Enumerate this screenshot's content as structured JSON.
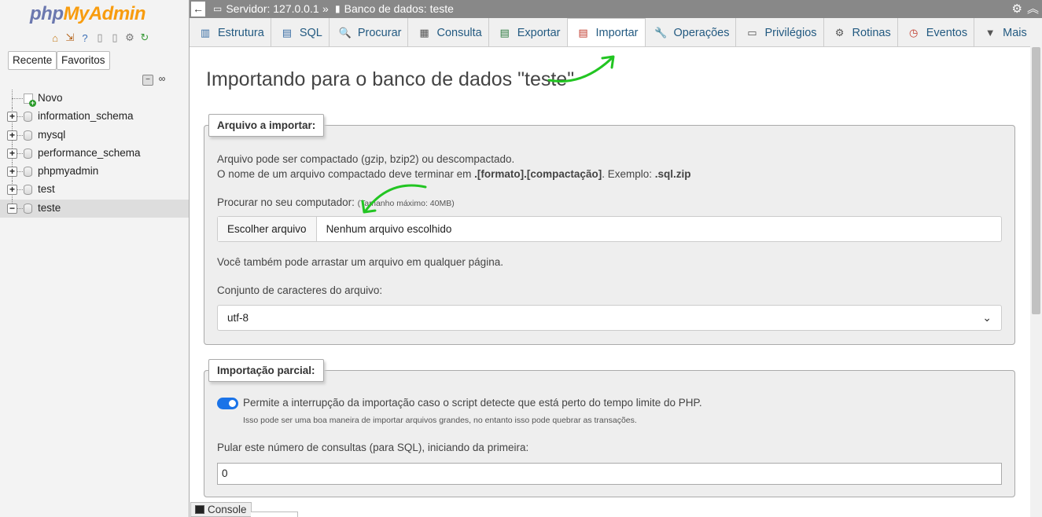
{
  "sidebar": {
    "logo_php": "php",
    "logo_myadmin": "MyAdmin",
    "tab_recent": "Recente",
    "tab_favorites": "Favoritos",
    "tree": [
      {
        "label": "Novo",
        "type": "new"
      },
      {
        "label": "information_schema",
        "type": "db"
      },
      {
        "label": "mysql",
        "type": "db"
      },
      {
        "label": "performance_schema",
        "type": "db"
      },
      {
        "label": "phpmyadmin",
        "type": "db"
      },
      {
        "label": "test",
        "type": "db"
      },
      {
        "label": "teste",
        "type": "db",
        "selected": true
      }
    ]
  },
  "topbar": {
    "server": "Servidor: 127.0.0.1",
    "separator": "»",
    "database": "Banco de dados: teste"
  },
  "tabs": [
    {
      "label": "Estrutura",
      "icon": "structure-icon"
    },
    {
      "label": "SQL",
      "icon": "sql-icon"
    },
    {
      "label": "Procurar",
      "icon": "search-icon"
    },
    {
      "label": "Consulta",
      "icon": "query-icon"
    },
    {
      "label": "Exportar",
      "icon": "export-icon"
    },
    {
      "label": "Importar",
      "icon": "import-icon",
      "active": true
    },
    {
      "label": "Operações",
      "icon": "wrench-icon"
    },
    {
      "label": "Privilégios",
      "icon": "privileges-icon"
    },
    {
      "label": "Rotinas",
      "icon": "routines-icon"
    },
    {
      "label": "Eventos",
      "icon": "clock-icon"
    },
    {
      "label": "Mais",
      "icon": "dropdown-icon"
    }
  ],
  "main": {
    "title": "Importando para o banco de dados \"teste\"",
    "file_section": {
      "legend": "Arquivo a importar:",
      "line1": "Arquivo pode ser compactado (gzip, bzip2) ou descompactado.",
      "line2_prefix": "O nome de um arquivo compactado deve terminar em ",
      "line2_bold": ".[formato].[compactação]",
      "line2_mid": ". Exemplo: ",
      "line2_example": ".sql.zip",
      "browse_label": "Procurar no seu computador:",
      "max_size": "(Tamanho máximo: 40MB)",
      "choose_button": "Escolher arquivo",
      "no_file": "Nenhum arquivo escolhido",
      "drag_hint": "Você também pode arrastar um arquivo em qualquer página.",
      "charset_label": "Conjunto de caracteres do arquivo:",
      "charset_value": "utf-8"
    },
    "partial_section": {
      "legend": "Importação parcial:",
      "toggle_label": "Permite a interrupção da importação caso o script detecte que está perto do tempo limite do PHP.",
      "toggle_on": true,
      "toggle_hint": "Isso pode ser uma boa maneira de importar arquivos grandes, no entanto isso pode quebrar as transações.",
      "skip_label": "Pular este número de consultas (para SQL), iniciando da primeira:",
      "skip_value": "0"
    }
  },
  "console": {
    "label": "Console"
  },
  "colors": {
    "accent": "#1a73e8",
    "link": "#235a81",
    "annotation": "#22c522"
  }
}
